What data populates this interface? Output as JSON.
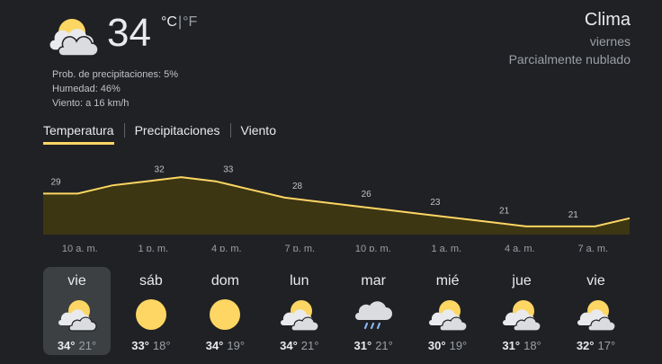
{
  "current": {
    "temperature": "34",
    "unit_c": "°C",
    "unit_sep": "|",
    "unit_f": "°F",
    "icon": "partly-cloudy-icon",
    "precip": "Prob. de precipitaciones: 5%",
    "humidity": "Humedad: 46%",
    "wind": "Viento: a 16 km/h"
  },
  "header": {
    "title": "Clima",
    "day": "viernes",
    "condition": "Parcialmente nublado"
  },
  "tabs": [
    {
      "label": "Temperatura",
      "active": true
    },
    {
      "label": "Precipitaciones",
      "active": false
    },
    {
      "label": "Viento",
      "active": false
    }
  ],
  "colors": {
    "accent": "#fdd663",
    "area_fill": "#3d3613",
    "background": "#202124",
    "selected_day": "#3c4043"
  },
  "chart_data": {
    "type": "area",
    "series": [
      {
        "values": [
          29,
          29,
          31,
          32,
          33,
          32,
          30,
          28,
          27,
          26,
          25,
          24,
          23,
          22,
          21,
          21,
          21,
          23
        ],
        "labels": [
          "29",
          "",
          "",
          "32",
          "",
          "33",
          "",
          "28",
          "",
          "26",
          "",
          "23",
          "",
          "21",
          "",
          "21",
          ""
        ]
      }
    ],
    "label_indices": [
      0,
      3,
      5,
      7,
      9,
      11,
      13,
      15
    ],
    "x_ticks": [
      "10 a. m.",
      "1 p. m.",
      "4 p. m.",
      "7 p. m.",
      "10 p. m.",
      "1 a. m.",
      "4 a. m.",
      "7 a. m."
    ],
    "ylim": [
      19,
      35
    ],
    "grid": false
  },
  "forecast": [
    {
      "day": "vie",
      "icon": "partly-cloudy-icon",
      "high": "34°",
      "low": "21°",
      "selected": true
    },
    {
      "day": "sáb",
      "icon": "sun-icon",
      "high": "33°",
      "low": "18°",
      "selected": false
    },
    {
      "day": "dom",
      "icon": "sun-icon",
      "high": "34°",
      "low": "19°",
      "selected": false
    },
    {
      "day": "lun",
      "icon": "partly-cloudy-icon",
      "high": "34°",
      "low": "21°",
      "selected": false
    },
    {
      "day": "mar",
      "icon": "rain-cloud-icon",
      "high": "31°",
      "low": "21°",
      "selected": false
    },
    {
      "day": "mié",
      "icon": "partly-cloudy-icon",
      "high": "30°",
      "low": "19°",
      "selected": false
    },
    {
      "day": "jue",
      "icon": "partly-cloudy-icon",
      "high": "31°",
      "low": "18°",
      "selected": false
    },
    {
      "day": "vie",
      "icon": "partly-cloudy-icon",
      "high": "32°",
      "low": "17°",
      "selected": false
    }
  ]
}
